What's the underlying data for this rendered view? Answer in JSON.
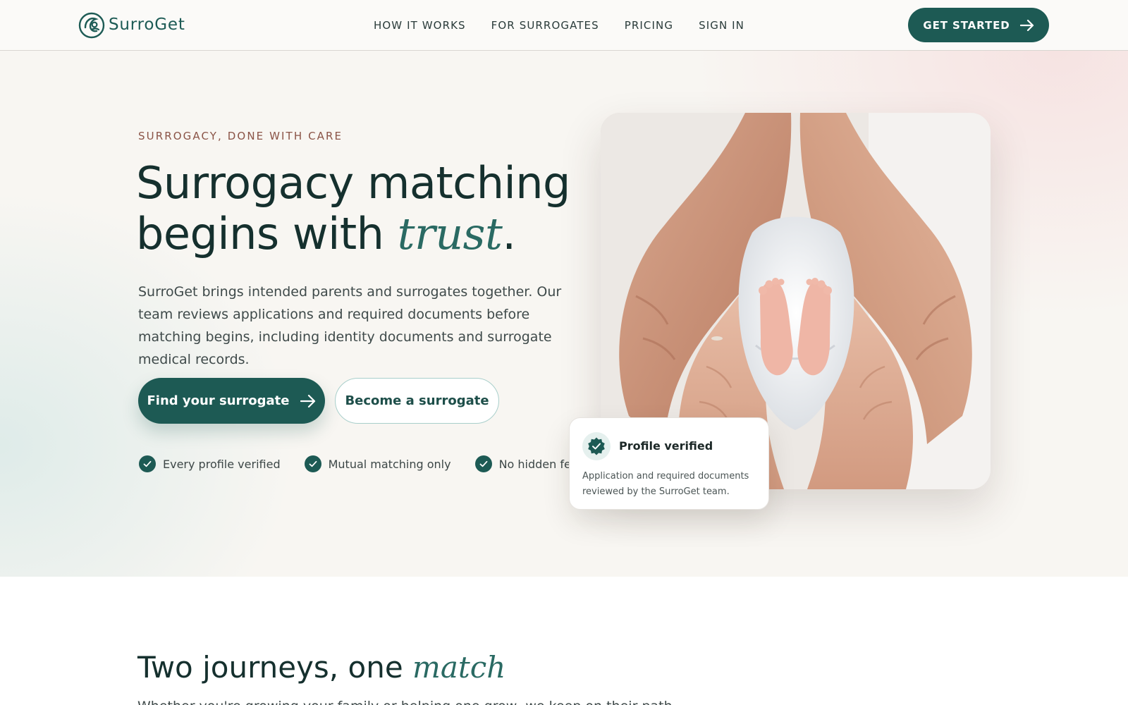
{
  "brand": {
    "name": "SurroGet",
    "logo_icon": "mother-child-icon"
  },
  "nav": {
    "links": [
      "HOW IT WORKS",
      "FOR SURROGATES",
      "PRICING",
      "SIGN IN"
    ],
    "cta": {
      "label": "GET STARTED",
      "icon": "arrow-right-icon"
    }
  },
  "hero": {
    "eyebrow": "SURROGACY, DONE WITH CARE",
    "headline_line1": "Surrogacy matching",
    "headline_line2_prefix": "begins with ",
    "headline_accent": "trust",
    "headline_suffix": ".",
    "lede": "SurroGet brings intended parents and surrogates together. Our team reviews applications and required documents before matching begins, including identity documents and surrogate medical records.",
    "primary_button": {
      "label": "Find your surrogate",
      "icon": "arrow-right-icon"
    },
    "secondary_button": {
      "label": "Become a surrogate"
    },
    "trust_points": [
      "Every profile verified",
      "Mutual matching only",
      "No hidden fees"
    ]
  },
  "verify_card": {
    "title": "Profile verified",
    "text": "Application and required documents reviewed by the SurroGet team.",
    "icon": "verified-badge-icon"
  },
  "section2": {
    "title_prefix": "Two journeys, one ",
    "title_accent": "match",
    "subtitle": "Whether you're growing your family or helping one grow, we keep on their path..."
  },
  "colors": {
    "primary": "#1d5a54",
    "accent_text": "#2a6a63",
    "eyebrow": "#8a5346",
    "hero_bg": "#f8f6f2"
  }
}
